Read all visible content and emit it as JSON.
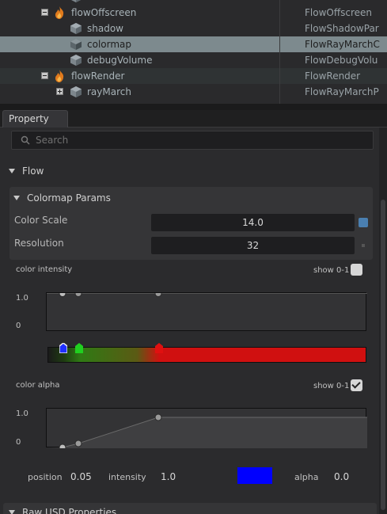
{
  "colors": {
    "panel_bg": "#2b2b2d",
    "selected_row": "#7d8a8e",
    "flame": "#e07a1c",
    "swatch_blue": "#4a7fb0",
    "alpha_color": "#0000ff"
  },
  "stage_tree": {
    "rows": [
      {
        "name": "flowOffscreen",
        "type": "FlowOffscreen",
        "icon": "flame-icon",
        "expanded": true
      },
      {
        "name": "shadow",
        "type": "FlowShadowPar",
        "icon": "cube-icon"
      },
      {
        "name": "colormap",
        "type": "FlowRayMarchC",
        "icon": "cube-icon",
        "selected": true
      },
      {
        "name": "debugVolume",
        "type": "FlowDebugVolu",
        "icon": "cube-icon"
      },
      {
        "name": "flowRender",
        "type": "FlowRender",
        "icon": "flame-icon",
        "expanded": true
      },
      {
        "name": "rayMarch",
        "type": "FlowRayMarchP",
        "icon": "cube-icon",
        "expanded": false
      }
    ]
  },
  "property": {
    "tab_label": "Property",
    "search_placeholder": "Search",
    "flow_header": "Flow",
    "colormap_header": "Colormap Params",
    "color_scale_label": "Color Scale",
    "color_scale_value": "14.0",
    "resolution_label": "Resolution",
    "resolution_value": "32",
    "color_intensity": {
      "label": "color intensity",
      "show01_label": "show 0-1",
      "show01_checked": false,
      "axis_top": "1.0",
      "axis_bottom": "0"
    },
    "color_alpha": {
      "label": "color alpha",
      "show01_label": "show 0-1",
      "show01_checked": true,
      "axis_top": "1.0",
      "axis_bottom": "0"
    },
    "footer": {
      "position_label": "position",
      "position_value": "0.05",
      "intensity_label": "intensity",
      "intensity_value": "1.0",
      "alpha_label": "alpha",
      "alpha_value": "0.0"
    },
    "raw_header": "Raw USD Properties"
  }
}
